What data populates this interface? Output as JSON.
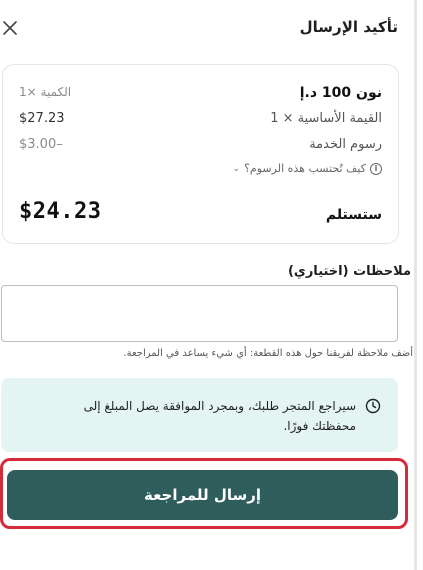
{
  "header": {
    "title": "تأكيد الإرسال"
  },
  "summary": {
    "item_name": "نون 100 د.إ",
    "quantity_label": "الكمية ×1",
    "base_value_label": "القيمة الأساسية × 1",
    "base_value_amount": "$27.23",
    "service_fee_label": "رسوم الخدمة",
    "service_fee_amount": "$3.00–",
    "fee_info_link": "كيف تُحتسب هذه الرسوم؟",
    "receive_label": "ستستلم",
    "receive_amount": "$24.23"
  },
  "notes": {
    "label": "ملاحظات (اختياري)",
    "value": "",
    "placeholder": "",
    "helper": "أضف ملاحظة لفريقنا حول هذه القطعة: أي شيء يساعد في المراجعة."
  },
  "notice": {
    "text": "سيراجع المتجر طلبك، وبمجرد الموافقة يصل المبلغ إلى محفظتك فورًا."
  },
  "actions": {
    "submit_label": "إرسال للمراجعة"
  },
  "colors": {
    "primary_button": "#2e5d5b",
    "notice_background": "#e3f4f2",
    "highlight_border": "#d62b3a"
  }
}
